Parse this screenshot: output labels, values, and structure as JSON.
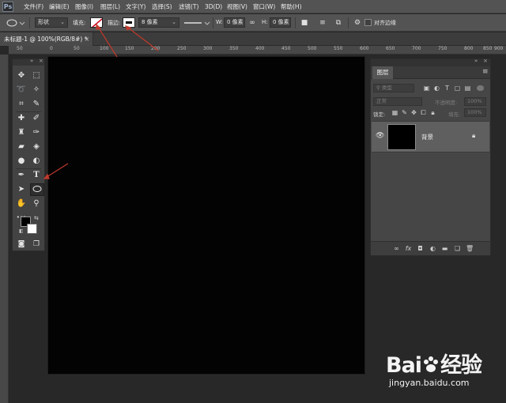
{
  "app": {
    "logo": "Ps",
    "menu": [
      "文件(F)",
      "编辑(E)",
      "图像(I)",
      "图层(L)",
      "文字(Y)",
      "选择(S)",
      "滤镜(T)",
      "3D(D)",
      "视图(V)",
      "窗口(W)",
      "帮助(H)"
    ]
  },
  "options": {
    "mode_value": "形状",
    "fill_label": "填充:",
    "stroke_label": "描边:",
    "stroke_width": "8 像素",
    "width_label": "W:",
    "width_value": "0 像素",
    "height_label": "H:",
    "height_value": "0 像素",
    "align_edges_label": "对齐边缘"
  },
  "document": {
    "tab_title": "未标题-1 @ 100%(RGB/8#) *",
    "ruler_labels": [
      "50",
      "0",
      "50",
      "100",
      "150",
      "200",
      "250",
      "300",
      "350",
      "400",
      "450",
      "500",
      "550",
      "600",
      "650",
      "700",
      "750",
      "800",
      "850",
      "900"
    ],
    "canvas_color": "#030304"
  },
  "toolbar": {
    "foreground_color": "#000000",
    "background_color": "#ffffff",
    "more_glyph": "•••"
  },
  "layers_panel": {
    "tab_label": "图层",
    "kind_placeholder": "类型",
    "blend_mode": "正常",
    "opacity_label": "不透明度:",
    "opacity_value": "100%",
    "lock_label": "锁定:",
    "fill_label": "填充:",
    "fill_value": "100%",
    "layer_name": "背景"
  },
  "colors": {
    "chrome": "#535353",
    "workspace": "#282828",
    "annotation": "#c0392b",
    "accent_blue": "#2b6fd6"
  },
  "watermark": {
    "brand": "Bai",
    "brand_suffix": "经验",
    "url": "jingyan.baidu.com"
  }
}
